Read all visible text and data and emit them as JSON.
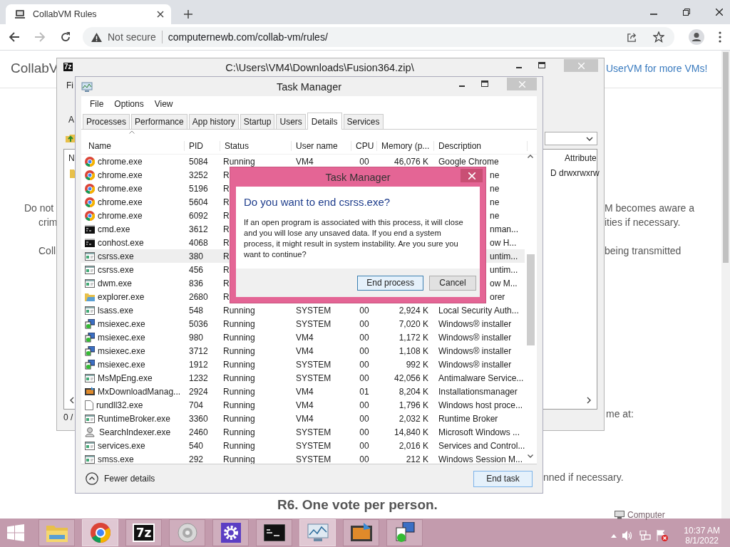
{
  "browser": {
    "tab_title": "CollabVM Rules",
    "security_label": "Not secure",
    "url": "computernewb.com/collab-vm/rules/"
  },
  "page_texts": [
    {
      "kind": "title",
      "text": "CollabV"
    },
    {
      "kind": "link",
      "text": "UserVM for more VMs!"
    },
    {
      "kind": "body",
      "text": "Do not"
    },
    {
      "kind": "body",
      "text": "crim"
    },
    {
      "kind": "body",
      "text": "Coll"
    },
    {
      "kind": "body",
      "text": "M becomes aware a"
    },
    {
      "kind": "body",
      "text": "ities if necessary."
    },
    {
      "kind": "body",
      "text": "being transmitted"
    },
    {
      "kind": "body",
      "text": "me at:"
    },
    {
      "kind": "body",
      "text": "nned if necessary."
    },
    {
      "kind": "heading",
      "text": "R6. One vote per person."
    }
  ],
  "archive_window": {
    "badge": "7z",
    "title": "C:\\Users\\VM4\\Downloads\\Fusion364.zip\\",
    "menu_fragment": "Fi",
    "toolbar_fragment": "A",
    "column_fragment": "N",
    "attribute_column": "Attribute",
    "attribute_value": "D drwxrwxrw",
    "status_fragment": "0 /"
  },
  "task_manager": {
    "title": "Task Manager",
    "menu": [
      "File",
      "Options",
      "View"
    ],
    "tabs": [
      {
        "label": "Processes",
        "selected": false
      },
      {
        "label": "Performance",
        "selected": false
      },
      {
        "label": "App history",
        "selected": false
      },
      {
        "label": "Startup",
        "selected": false
      },
      {
        "label": "Users",
        "selected": false
      },
      {
        "label": "Details",
        "selected": true
      },
      {
        "label": "Services",
        "selected": false
      }
    ],
    "columns": [
      "Name",
      "PID",
      "Status",
      "User name",
      "CPU",
      "Memory (p...",
      "Description"
    ],
    "rows": [
      {
        "kind": "chrome",
        "name": "chrome.exe",
        "pid": "5084",
        "status": "Running",
        "user": "VM4",
        "cpu": "00",
        "memory": "46,076 K",
        "description": "Google Chrome",
        "selected": false
      },
      {
        "kind": "chrome",
        "name": "chrome.exe",
        "pid": "3252",
        "status": "R",
        "description": "ne",
        "selected": false
      },
      {
        "kind": "chrome",
        "name": "chrome.exe",
        "pid": "5196",
        "status": "R",
        "description": "ne",
        "selected": false
      },
      {
        "kind": "chrome",
        "name": "chrome.exe",
        "pid": "5604",
        "status": "R",
        "description": "ne",
        "selected": false
      },
      {
        "kind": "chrome",
        "name": "chrome.exe",
        "pid": "6092",
        "status": "R",
        "description": "ne",
        "selected": false
      },
      {
        "kind": "console",
        "name": "cmd.exe",
        "pid": "3612",
        "status": "R",
        "description": "nman...",
        "selected": false
      },
      {
        "kind": "console",
        "name": "conhost.exe",
        "pid": "4068",
        "status": "R",
        "description": "ow H...",
        "selected": false
      },
      {
        "kind": "window",
        "name": "csrss.exe",
        "pid": "380",
        "status": "R",
        "description": "untim...",
        "selected": true
      },
      {
        "kind": "window",
        "name": "csrss.exe",
        "pid": "456",
        "status": "R",
        "description": "untim...",
        "selected": false
      },
      {
        "kind": "window",
        "name": "dwm.exe",
        "pid": "836",
        "status": "R",
        "description": "ow M...",
        "selected": false
      },
      {
        "kind": "folder",
        "name": "explorer.exe",
        "pid": "2680",
        "status": "R",
        "description": "orer",
        "selected": false
      },
      {
        "kind": "window",
        "name": "lsass.exe",
        "pid": "548",
        "status": "Running",
        "user": "SYSTEM",
        "cpu": "00",
        "memory": "2,924 K",
        "description": "Local Security Auth...",
        "selected": false
      },
      {
        "kind": "installer",
        "name": "msiexec.exe",
        "pid": "5036",
        "status": "Running",
        "user": "SYSTEM",
        "cpu": "00",
        "memory": "7,020 K",
        "description": "Windows® installer",
        "selected": false
      },
      {
        "kind": "installer",
        "name": "msiexec.exe",
        "pid": "980",
        "status": "Running",
        "user": "VM4",
        "cpu": "00",
        "memory": "1,172 K",
        "description": "Windows® installer",
        "selected": false
      },
      {
        "kind": "installer",
        "name": "msiexec.exe",
        "pid": "3712",
        "status": "Running",
        "user": "VM4",
        "cpu": "00",
        "memory": "1,108 K",
        "description": "Windows® installer",
        "selected": false
      },
      {
        "kind": "installer",
        "name": "msiexec.exe",
        "pid": "1912",
        "status": "Running",
        "user": "SYSTEM",
        "cpu": "00",
        "memory": "992 K",
        "description": "Windows® installer",
        "selected": false
      },
      {
        "kind": "window",
        "name": "MsMpEng.exe",
        "pid": "1232",
        "status": "Running",
        "user": "SYSTEM",
        "cpu": "00",
        "memory": "42,056 K",
        "description": "Antimalware Service...",
        "selected": false
      },
      {
        "kind": "media",
        "name": "MxDownloadManag...",
        "pid": "2924",
        "status": "Running",
        "user": "VM4",
        "cpu": "01",
        "memory": "8,204 K",
        "description": "Installationsmanager",
        "selected": false
      },
      {
        "kind": "document",
        "name": "rundll32.exe",
        "pid": "704",
        "status": "Running",
        "user": "VM4",
        "cpu": "00",
        "memory": "1,796 K",
        "description": "Windows host proce...",
        "selected": false
      },
      {
        "kind": "window",
        "name": "RuntimeBroker.exe",
        "pid": "3360",
        "status": "Running",
        "user": "VM4",
        "cpu": "00",
        "memory": "2,032 K",
        "description": "Runtime Broker",
        "selected": false
      },
      {
        "kind": "search",
        "name": "SearchIndexer.exe",
        "pid": "2460",
        "status": "Running",
        "user": "SYSTEM",
        "cpu": "00",
        "memory": "14,840 K",
        "description": "Microsoft Windows ...",
        "selected": false
      },
      {
        "kind": "window",
        "name": "services.exe",
        "pid": "540",
        "status": "Running",
        "user": "SYSTEM",
        "cpu": "00",
        "memory": "2,016 K",
        "description": "Services and Control...",
        "selected": false
      },
      {
        "kind": "window",
        "name": "smss.exe",
        "pid": "292",
        "status": "Running",
        "user": "SYSTEM",
        "cpu": "00",
        "memory": "212 K",
        "description": "Windows Session M...",
        "selected": false
      }
    ],
    "fewer_details": "Fewer details",
    "end_task": "End task"
  },
  "dialog": {
    "title": "Task Manager",
    "heading": "Do you want to end csrss.exe?",
    "message": "If an open program is associated with this process, it will close and you will lose any unsaved data. If you end a system process, it might result in system instability. Are you sure you want to continue?",
    "buttons": [
      {
        "label": "End process",
        "default": true
      },
      {
        "label": "Cancel",
        "default": false
      }
    ]
  },
  "taskbar": {
    "apps": [
      {
        "kind": "explorer",
        "active": false
      },
      {
        "kind": "chrome",
        "active": true
      },
      {
        "kind": "archiver",
        "label": "7z",
        "active": false
      },
      {
        "kind": "speaker",
        "active": false
      },
      {
        "kind": "settings",
        "active": false
      },
      {
        "kind": "console",
        "active": false
      },
      {
        "kind": "monitor",
        "active": true
      },
      {
        "kind": "media",
        "active": false
      },
      {
        "kind": "installer",
        "active": false
      }
    ],
    "tray_label": "Computer",
    "time": "10:37 AM",
    "date": "8/1/2022"
  }
}
